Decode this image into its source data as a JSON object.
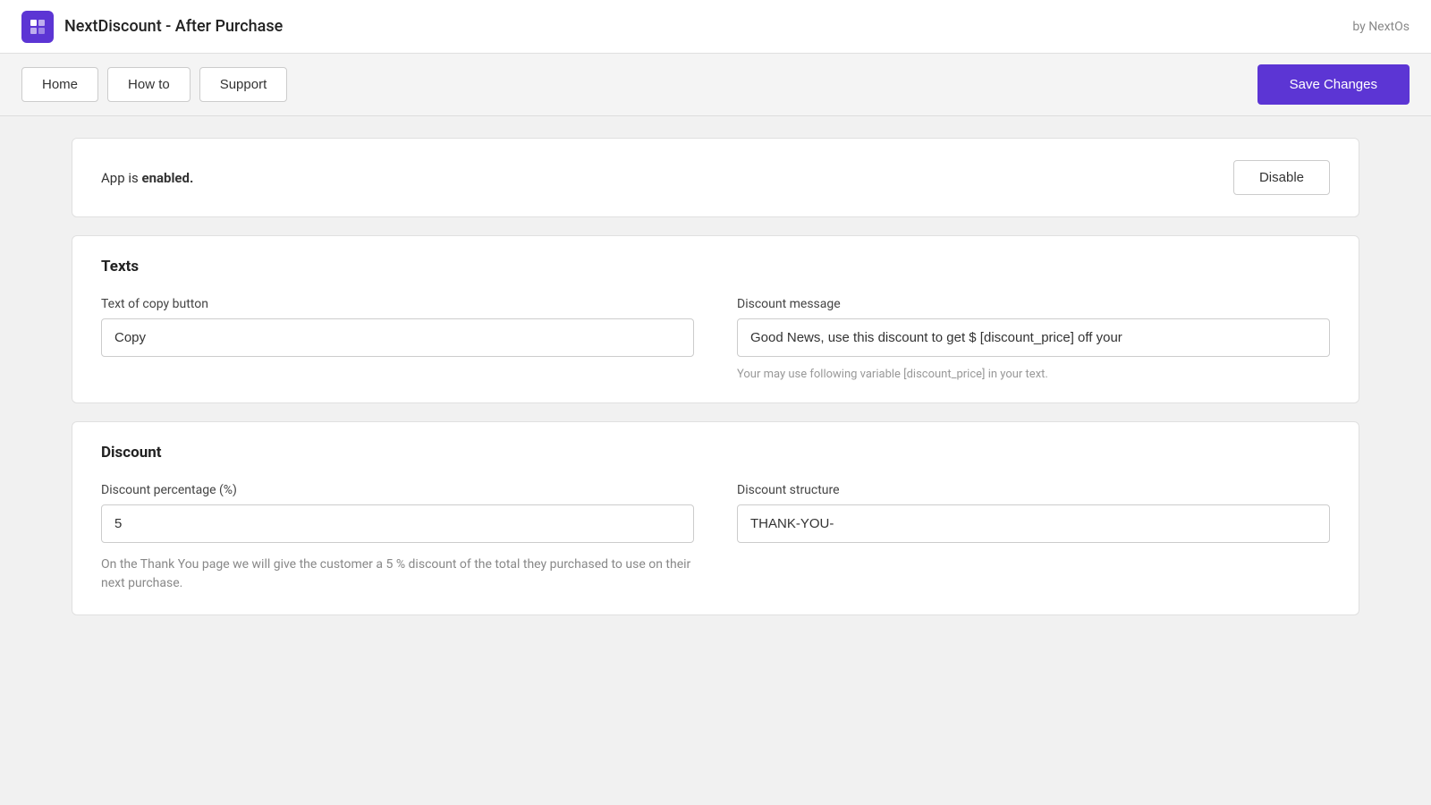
{
  "topBar": {
    "appTitle": "NextDiscount - After Purchase",
    "byText": "by NextOs",
    "logoSymbol": "✦"
  },
  "nav": {
    "homeLabel": "Home",
    "howToLabel": "How to",
    "supportLabel": "Support",
    "saveChangesLabel": "Save Changes"
  },
  "statusCard": {
    "statusPrefix": "App is ",
    "statusBold": "enabled.",
    "disableLabel": "Disable"
  },
  "textsSection": {
    "title": "Texts",
    "copyButtonLabel": "Text of copy button",
    "copyButtonValue": "Copy",
    "discountMessageLabel": "Discount message",
    "discountMessageValue": "Good News, use this discount to get $ [discount_price] off your",
    "discountMessageHint": "Your may use following variable [discount_price] in your text."
  },
  "discountSection": {
    "title": "Discount",
    "percentageLabel": "Discount percentage (%)",
    "percentageValue": "5",
    "percentageDescription": "On the Thank You page we will give the customer a 5 % discount of the total they purchased to use on their next purchase.",
    "structureLabel": "Discount structure",
    "structureValue": "THANK-YOU-"
  }
}
